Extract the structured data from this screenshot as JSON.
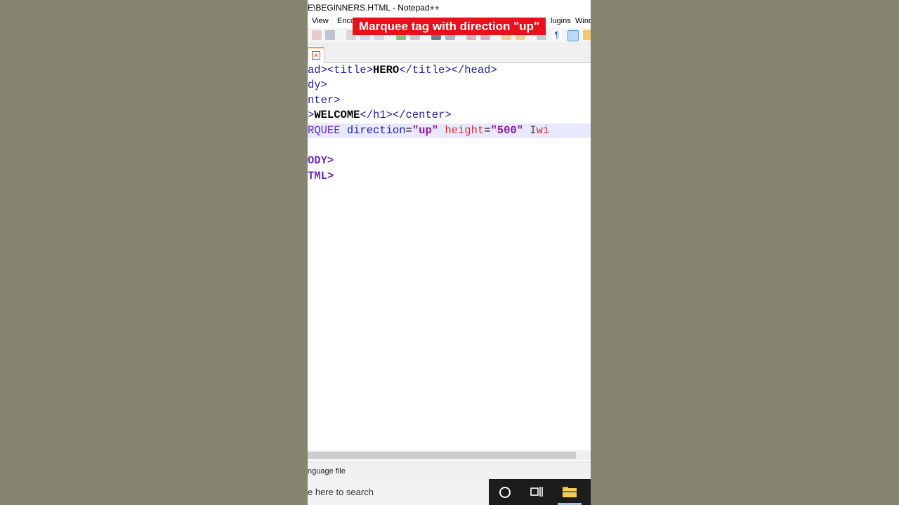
{
  "window": {
    "title": "E\\BEGINNERS.HTML - Notepad++"
  },
  "menu": {
    "items": [
      "View",
      "Enco",
      "lugins",
      "Wind"
    ]
  },
  "caption": {
    "text": "Marquee tag with direction \"up\"",
    "color": "#e8101a"
  },
  "editor": {
    "lines": {
      "l1": {
        "a": "ad><title>",
        "b": "HERO",
        "c": "</title></head>"
      },
      "l2": {
        "a": "dy>"
      },
      "l3": {
        "a": "nter>"
      },
      "l4": {
        "a": ">",
        "b": "WELCOME",
        "c": "</h1></center>"
      },
      "l5": {
        "a": "RQUEE",
        "b": " direction",
        "c": "=",
        "d": "\"up\"",
        "e": " height",
        "f": "=",
        "g": "\"500\"",
        "h": " ",
        "i": "I",
        "j": "wi"
      },
      "l7": {
        "a": "ODY>"
      },
      "l8": {
        "a": "TML>"
      }
    },
    "highlight_color": "#e8e8ff"
  },
  "statusbar": {
    "text": "nguage file"
  },
  "taskbar": {
    "search_placeholder": "e here to search",
    "icons": [
      "cortana-icon",
      "task-view-icon",
      "file-explorer-icon"
    ]
  },
  "background_color": "#85846f"
}
